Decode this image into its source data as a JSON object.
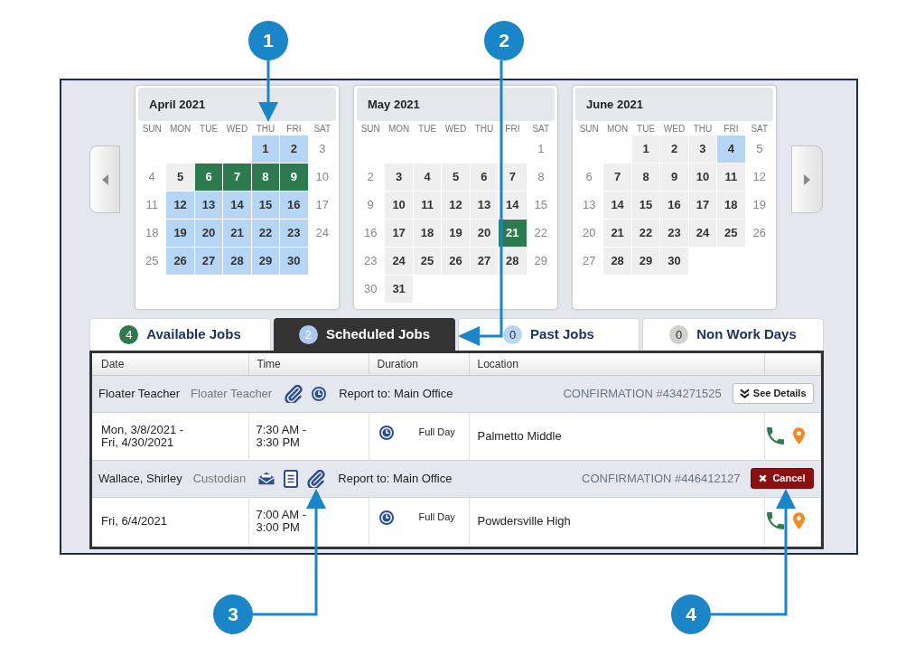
{
  "calendar": {
    "months": [
      {
        "title": "April 2021",
        "weekdays": [
          "SUN",
          "MON",
          "TUE",
          "WED",
          "THU",
          "FRI",
          "SAT"
        ],
        "weeks": [
          [
            {
              "kind": "blank"
            },
            {
              "kind": "blank"
            },
            {
              "kind": "blank"
            },
            {
              "kind": "blank"
            },
            {
              "day": "1",
              "kind": "weekday",
              "color": "#b6d4f4"
            },
            {
              "day": "2",
              "kind": "weekday",
              "color": "#b6d4f4"
            },
            {
              "day": "3",
              "kind": "weekend"
            }
          ],
          [
            {
              "day": "4",
              "kind": "weekend"
            },
            {
              "day": "5",
              "kind": "weekday"
            },
            {
              "day": "6",
              "kind": "weekday",
              "color": "#2d7a4f"
            },
            {
              "day": "7",
              "kind": "weekday",
              "color": "#2d7a4f"
            },
            {
              "day": "8",
              "kind": "weekday",
              "color": "#2d7a4f"
            },
            {
              "day": "9",
              "kind": "weekday",
              "color": "#2d7a4f"
            },
            {
              "day": "10",
              "kind": "weekend"
            }
          ],
          [
            {
              "day": "11",
              "kind": "weekend"
            },
            {
              "day": "12",
              "kind": "weekday",
              "color": "#b6d4f4"
            },
            {
              "day": "13",
              "kind": "weekday",
              "color": "#b6d4f4"
            },
            {
              "day": "14",
              "kind": "weekday",
              "color": "#b6d4f4"
            },
            {
              "day": "15",
              "kind": "weekday",
              "color": "#b6d4f4"
            },
            {
              "day": "16",
              "kind": "weekday",
              "color": "#b6d4f4"
            },
            {
              "day": "17",
              "kind": "weekend"
            }
          ],
          [
            {
              "day": "18",
              "kind": "weekend"
            },
            {
              "day": "19",
              "kind": "weekday",
              "color": "#b6d4f4"
            },
            {
              "day": "20",
              "kind": "weekday",
              "color": "#b6d4f4"
            },
            {
              "day": "21",
              "kind": "weekday",
              "color": "#b6d4f4"
            },
            {
              "day": "22",
              "kind": "weekday",
              "color": "#b6d4f4"
            },
            {
              "day": "23",
              "kind": "weekday",
              "color": "#b6d4f4"
            },
            {
              "day": "24",
              "kind": "weekend"
            }
          ],
          [
            {
              "day": "25",
              "kind": "weekend"
            },
            {
              "day": "26",
              "kind": "weekday",
              "color": "#b6d4f4"
            },
            {
              "day": "27",
              "kind": "weekday",
              "color": "#b6d4f4"
            },
            {
              "day": "28",
              "kind": "weekday",
              "color": "#b6d4f4"
            },
            {
              "day": "29",
              "kind": "weekday",
              "color": "#b6d4f4"
            },
            {
              "day": "30",
              "kind": "weekday",
              "color": "#b6d4f4"
            }
          ]
        ]
      },
      {
        "title": "May 2021",
        "weekdays": [
          "SUN",
          "MON",
          "TUE",
          "WED",
          "THU",
          "FRI",
          "SAT"
        ],
        "weeks": [
          [
            {
              "kind": "blank"
            },
            {
              "kind": "blank"
            },
            {
              "kind": "blank"
            },
            {
              "kind": "blank"
            },
            {
              "kind": "blank"
            },
            {
              "kind": "blank"
            },
            {
              "day": "1",
              "kind": "weekend"
            }
          ],
          [
            {
              "day": "2",
              "kind": "weekend"
            },
            {
              "day": "3",
              "kind": "weekday"
            },
            {
              "day": "4",
              "kind": "weekday"
            },
            {
              "day": "5",
              "kind": "weekday"
            },
            {
              "day": "6",
              "kind": "weekday"
            },
            {
              "day": "7",
              "kind": "weekday"
            },
            {
              "day": "8",
              "kind": "weekend"
            }
          ],
          [
            {
              "day": "9",
              "kind": "weekend"
            },
            {
              "day": "10",
              "kind": "weekday"
            },
            {
              "day": "11",
              "kind": "weekday"
            },
            {
              "day": "12",
              "kind": "weekday"
            },
            {
              "day": "13",
              "kind": "weekday"
            },
            {
              "day": "14",
              "kind": "weekday"
            },
            {
              "day": "15",
              "kind": "weekend"
            }
          ],
          [
            {
              "day": "16",
              "kind": "weekend"
            },
            {
              "day": "17",
              "kind": "weekday"
            },
            {
              "day": "18",
              "kind": "weekday"
            },
            {
              "day": "19",
              "kind": "weekday"
            },
            {
              "day": "20",
              "kind": "weekday"
            },
            {
              "day": "21",
              "kind": "weekday",
              "color": "#2d7a4f"
            },
            {
              "day": "22",
              "kind": "weekend"
            }
          ],
          [
            {
              "day": "23",
              "kind": "weekend"
            },
            {
              "day": "24",
              "kind": "weekday"
            },
            {
              "day": "25",
              "kind": "weekday"
            },
            {
              "day": "26",
              "kind": "weekday"
            },
            {
              "day": "27",
              "kind": "weekday"
            },
            {
              "day": "28",
              "kind": "weekday"
            },
            {
              "day": "29",
              "kind": "weekend"
            }
          ],
          [
            {
              "day": "30",
              "kind": "weekend"
            },
            {
              "day": "31",
              "kind": "weekday"
            }
          ]
        ]
      },
      {
        "title": "June 2021",
        "weekdays": [
          "SUN",
          "MON",
          "TUE",
          "WED",
          "THU",
          "FRI",
          "SAT"
        ],
        "weeks": [
          [
            {
              "kind": "blank"
            },
            {
              "kind": "blank"
            },
            {
              "day": "1",
              "kind": "weekday"
            },
            {
              "day": "2",
              "kind": "weekday"
            },
            {
              "day": "3",
              "kind": "weekday"
            },
            {
              "day": "4",
              "kind": "weekday",
              "color": "#b6d4f4"
            },
            {
              "day": "5",
              "kind": "weekend"
            }
          ],
          [
            {
              "day": "6",
              "kind": "weekend"
            },
            {
              "day": "7",
              "kind": "weekday"
            },
            {
              "day": "8",
              "kind": "weekday"
            },
            {
              "day": "9",
              "kind": "weekday"
            },
            {
              "day": "10",
              "kind": "weekday"
            },
            {
              "day": "11",
              "kind": "weekday"
            },
            {
              "day": "12",
              "kind": "weekend"
            }
          ],
          [
            {
              "day": "13",
              "kind": "weekend"
            },
            {
              "day": "14",
              "kind": "weekday"
            },
            {
              "day": "15",
              "kind": "weekday"
            },
            {
              "day": "16",
              "kind": "weekday"
            },
            {
              "day": "17",
              "kind": "weekday"
            },
            {
              "day": "18",
              "kind": "weekday"
            },
            {
              "day": "19",
              "kind": "weekend"
            }
          ],
          [
            {
              "day": "20",
              "kind": "weekend"
            },
            {
              "day": "21",
              "kind": "weekday"
            },
            {
              "day": "22",
              "kind": "weekday"
            },
            {
              "day": "23",
              "kind": "weekday"
            },
            {
              "day": "24",
              "kind": "weekday"
            },
            {
              "day": "25",
              "kind": "weekday"
            },
            {
              "day": "26",
              "kind": "weekend"
            }
          ],
          [
            {
              "day": "27",
              "kind": "weekend"
            },
            {
              "day": "28",
              "kind": "weekday"
            },
            {
              "day": "29",
              "kind": "weekday"
            },
            {
              "day": "30",
              "kind": "weekday"
            }
          ]
        ]
      }
    ]
  },
  "tabs": [
    {
      "label": "Available Jobs",
      "badge": {
        "count": "4",
        "color": "#2d7a4f"
      },
      "selected": false
    },
    {
      "label": "Scheduled Jobs",
      "badge": {
        "count": "2",
        "color": "#a9c9ef"
      },
      "selected": true
    },
    {
      "label": "Past Jobs",
      "badge": {
        "count": "0",
        "color": "#b9d6f5"
      },
      "selected": false
    },
    {
      "label": "Non Work Days",
      "badge": {
        "count": "0",
        "color": "#d0d0d0"
      },
      "selected": false
    }
  ],
  "table": {
    "columns": [
      "Date",
      "Time",
      "Duration",
      "Location"
    ],
    "jobs": [
      {
        "title": "Floater Teacher",
        "role": "Floater Teacher",
        "indicators": [
          {
            "kind": "attachment"
          },
          {
            "kind": "time"
          }
        ],
        "report_to": "Report to: Main Office",
        "confirmation": "CONFIRMATION #434271525",
        "action": {
          "kind": "details",
          "label": "See Details"
        },
        "date": "Mon, 3/8/2021 - Fri, 4/30/2021",
        "time": "7:30 AM - 3:30 PM",
        "duration": "Full Day",
        "location": "Palmetto Middle"
      },
      {
        "title": "Wallace, Shirley",
        "role": "Custodian",
        "indicators": [
          {
            "kind": "message"
          },
          {
            "kind": "document"
          },
          {
            "kind": "attachment"
          }
        ],
        "report_to": "Report to: Main Office",
        "confirmation": "CONFIRMATION #446412127",
        "action": {
          "kind": "cancel",
          "label": "Cancel"
        },
        "date": "Fri, 6/4/2021",
        "time": "7:00 AM - 3:00 PM",
        "duration": "Full Day",
        "location": "Powdersville High"
      }
    ]
  },
  "callouts": [
    {
      "number": "1"
    },
    {
      "number": "2"
    },
    {
      "number": "3"
    },
    {
      "number": "4"
    }
  ]
}
